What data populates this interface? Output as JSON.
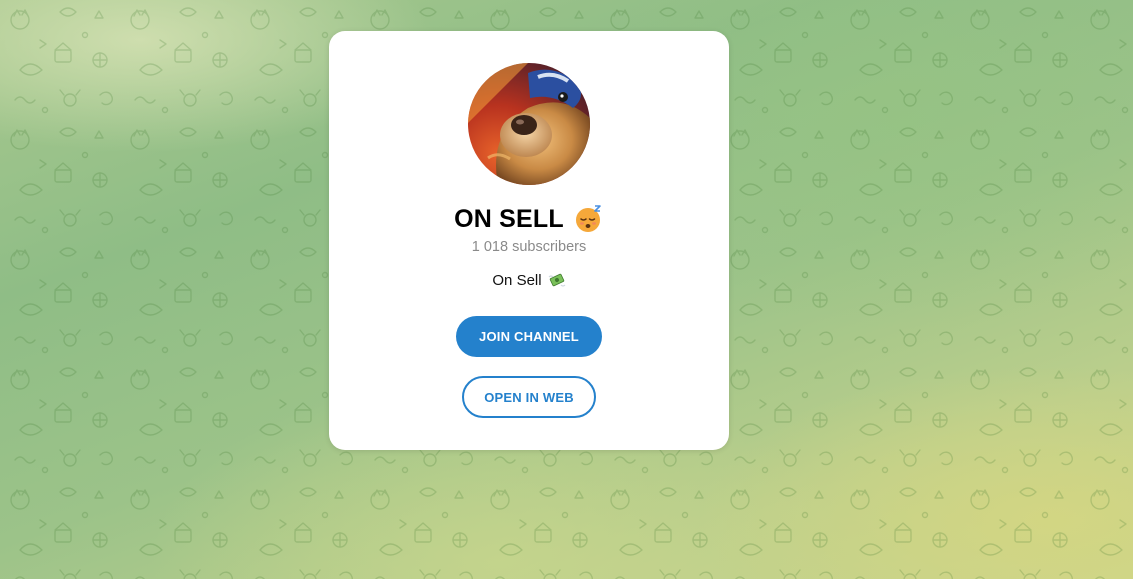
{
  "channel": {
    "title": "ON SELL",
    "title_emoji": "sleeping-face-emoji",
    "subscribers": "1 018 subscribers",
    "description": "On Sell",
    "description_emoji": "money-with-wings-emoji"
  },
  "actions": {
    "join_label": "JOIN CHANNEL",
    "open_web_label": "OPEN IN WEB"
  },
  "colors": {
    "accent": "#2481cc",
    "background_green": "#95c087",
    "background_yellow": "#ccd58a"
  },
  "icons": {
    "background_pattern": "doodle-pattern",
    "avatar": "channel-avatar"
  }
}
